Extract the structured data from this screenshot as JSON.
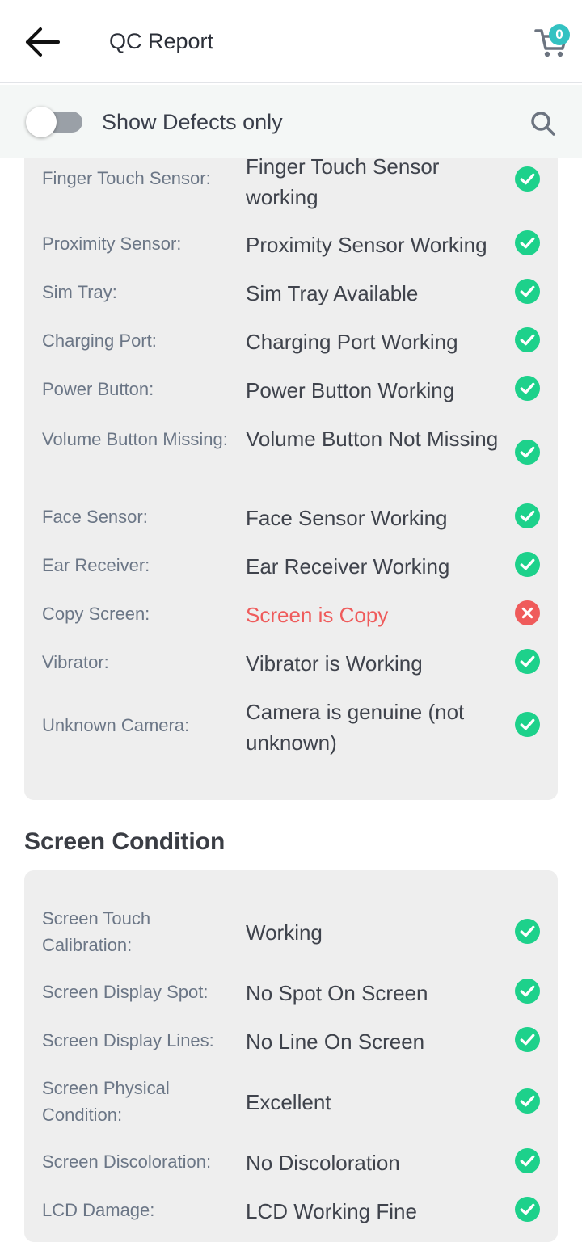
{
  "header": {
    "title": "QC Report",
    "cart_count": "0"
  },
  "filter": {
    "label": "Show Defects only"
  },
  "colors": {
    "ok": "#1dd18b",
    "defect": "#ef5b5b",
    "accent": "#33c2c2"
  },
  "sections": {
    "functional": {
      "rows": [
        {
          "label": "Finger Touch Sensor:",
          "value": "Finger Touch Sensor working",
          "status": "ok"
        },
        {
          "label": "Proximity Sensor:",
          "value": "Proximity Sensor Working",
          "status": "ok"
        },
        {
          "label": "Sim Tray:",
          "value": "Sim Tray Available",
          "status": "ok"
        },
        {
          "label": "Charging Port:",
          "value": "Charging Port Working",
          "status": "ok"
        },
        {
          "label": "Power Button:",
          "value": "Power Button Working",
          "status": "ok"
        },
        {
          "label": "Volume Button Missing:",
          "value": "Volume Button Not Missing",
          "status": "ok"
        },
        {
          "label": "Face Sensor:",
          "value": "Face Sensor Working",
          "status": "ok"
        },
        {
          "label": "Ear Receiver:",
          "value": "Ear Receiver Working",
          "status": "ok"
        },
        {
          "label": "Copy Screen:",
          "value": "Screen is Copy",
          "status": "defect"
        },
        {
          "label": "Vibrator:",
          "value": "Vibrator is Working",
          "status": "ok"
        },
        {
          "label": "Unknown Camera:",
          "value": "Camera is genuine (not unknown)",
          "status": "ok"
        }
      ]
    },
    "screen": {
      "title": "Screen Condition",
      "rows": [
        {
          "label": "Screen Touch Calibration:",
          "value": "Working",
          "status": "ok"
        },
        {
          "label": "Screen Display Spot:",
          "value": "No Spot On Screen",
          "status": "ok"
        },
        {
          "label": "Screen Display Lines:",
          "value": "No Line On Screen",
          "status": "ok"
        },
        {
          "label": "Screen Physical Condition:",
          "value": "Excellent",
          "status": "ok"
        },
        {
          "label": "Screen Discoloration:",
          "value": "No Discoloration",
          "status": "ok"
        },
        {
          "label": "LCD Damage:",
          "value": "LCD Working Fine",
          "status": "ok"
        }
      ]
    }
  }
}
